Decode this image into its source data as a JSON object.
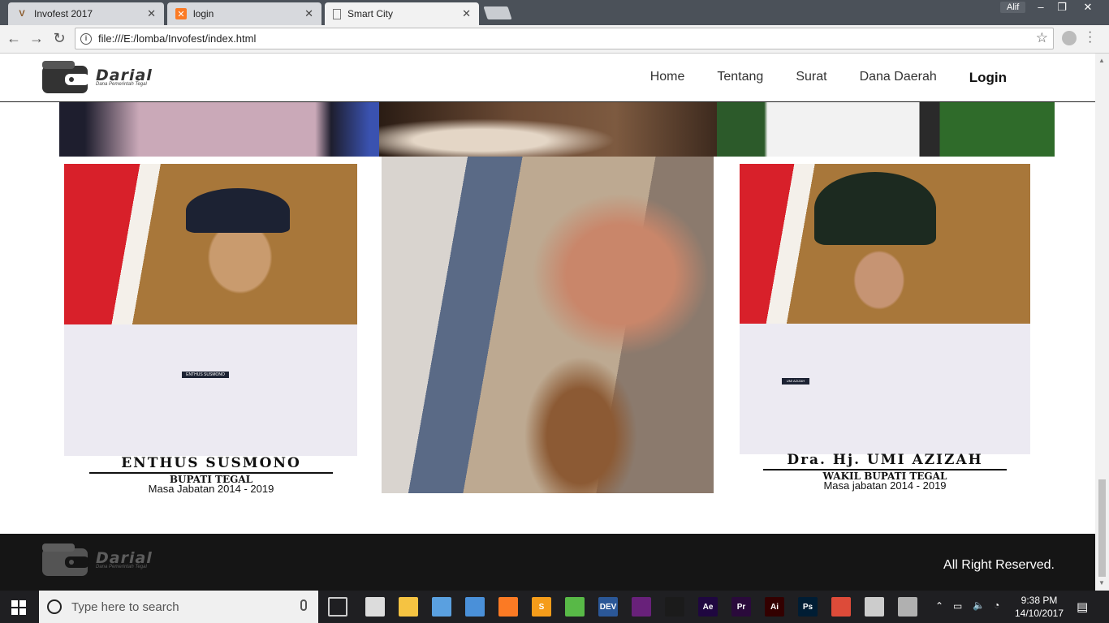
{
  "browser": {
    "tabs": [
      {
        "label": "Invofest 2017",
        "icon": "v-logo-icon"
      },
      {
        "label": "login",
        "icon": "xampp-icon"
      },
      {
        "label": "Smart City",
        "icon": "page-icon"
      }
    ],
    "user": "Alif",
    "url": "file:///E:/lomba/Invofest/index.html"
  },
  "site": {
    "logo_name": "Darial",
    "logo_tagline": "Dana Pemerintah Tegal",
    "nav": [
      "Home",
      "Tentang",
      "Surat",
      "Dana Daerah",
      "Login"
    ],
    "leaders": [
      {
        "name": "ENTHUS SUSMONO",
        "title": "BUPATI TEGAL",
        "term": "Masa Jabatan 2014 - 2019",
        "badge": "ENTHUS SUSMONO"
      },
      {
        "name": "Dra. Hj. UMI AZIZAH",
        "title": "WAKIL BUPATI TEGAL",
        "term": "Masa jabatan  2014 - 2019",
        "badge": "UMI AZIZAH"
      }
    ],
    "footer_text": "All Right Reserved."
  },
  "taskbar": {
    "search_placeholder": "Type here to search",
    "time": "9:38 PM",
    "date": "14/10/2017",
    "apps": [
      {
        "label": "",
        "color": "#dcdcdc"
      },
      {
        "label": "",
        "color": "#f5c342"
      },
      {
        "label": "",
        "color": "#5aa0e0"
      },
      {
        "label": "",
        "color": "#4a90d9"
      },
      {
        "label": "",
        "color": "#fb7a24"
      },
      {
        "label": "S",
        "color": "#f59c1a"
      },
      {
        "label": "",
        "color": "#58b947"
      },
      {
        "label": "DEV",
        "color": "#2b5797"
      },
      {
        "label": "",
        "color": "#68217a"
      },
      {
        "label": "",
        "color": "#1b1b1b"
      },
      {
        "label": "Ae",
        "color": "#1f0740"
      },
      {
        "label": "Pr",
        "color": "#2a0a3b"
      },
      {
        "label": "Ai",
        "color": "#330000"
      },
      {
        "label": "Ps",
        "color": "#001d34"
      },
      {
        "label": "",
        "color": "#dd4b39"
      },
      {
        "label": "",
        "color": "#cccccc"
      },
      {
        "label": "",
        "color": "#b0b0b0"
      }
    ]
  },
  "colors": {
    "accent": "#151515",
    "tabstrip": "#4b5159"
  }
}
